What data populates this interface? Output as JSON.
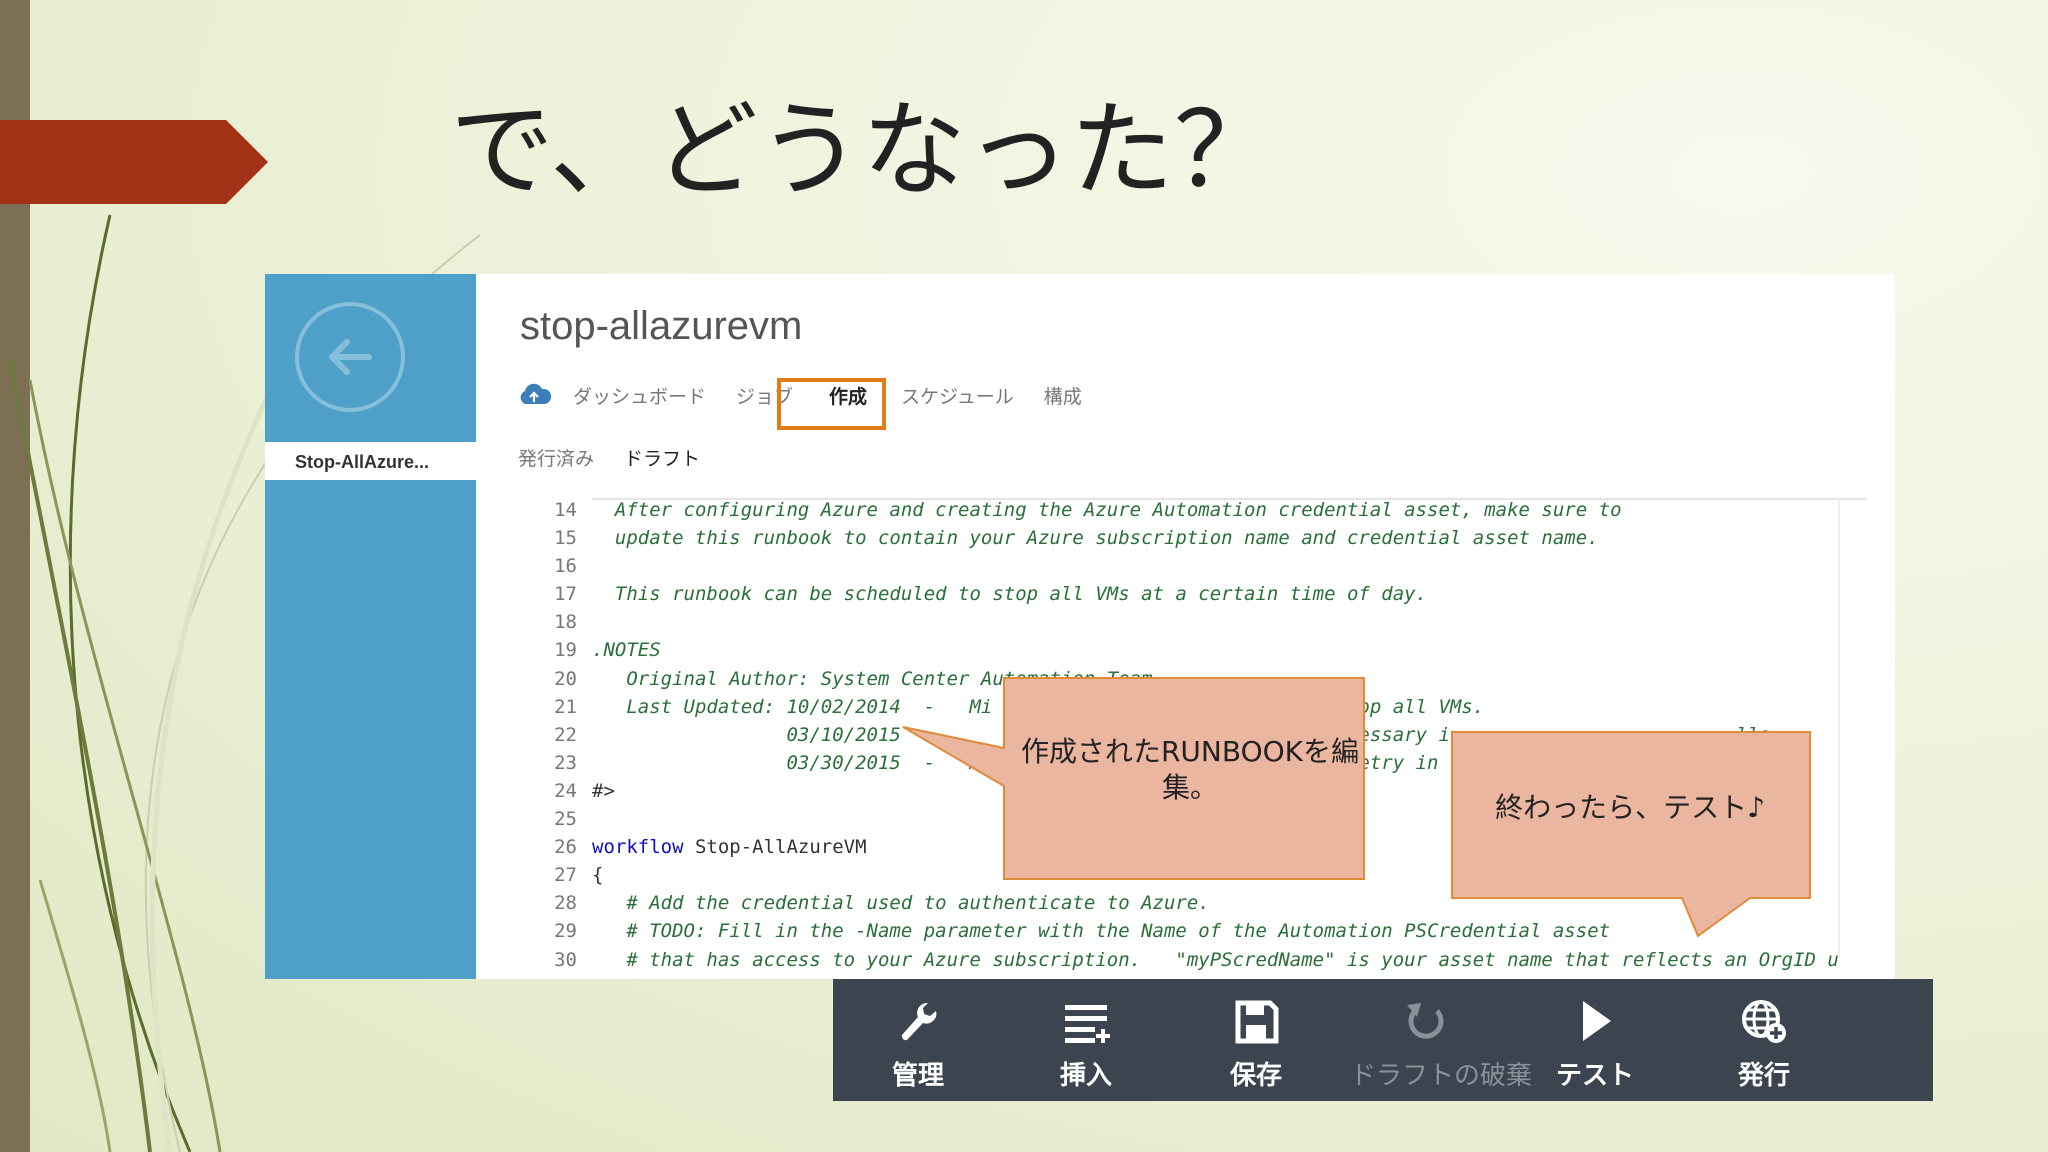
{
  "slide": {
    "title": "で、どうなった？"
  },
  "runbook": {
    "sidebar_item": "Stop-AllAzure...",
    "title": "stop-allazurevm",
    "tabs": [
      "ダッシュボード",
      "ジョブ",
      "作成",
      "スケジュール",
      "構成"
    ],
    "active_tab": "作成",
    "subtabs": [
      "発行済み",
      "ドラフト"
    ],
    "active_subtab": "ドラフト",
    "code_lines": [
      {
        "n": "14",
        "text": "  After configuring Azure and creating the Azure Automation credential asset, make sure to"
      },
      {
        "n": "15",
        "text": "  update this runbook to contain your Azure subscription name and credential asset name."
      },
      {
        "n": "16",
        "text": ""
      },
      {
        "n": "17",
        "text": "  This runbook can be scheduled to stop all VMs at a certain time of day."
      },
      {
        "n": "18",
        "text": ""
      },
      {
        "n": "19",
        "text": ".NOTES"
      },
      {
        "n": "20",
        "text": "   Original Author: System Center Automation Team"
      },
      {
        "n": "21",
        "text": "   Last Updated: 10/02/2014  -   Mi                               top all VMs."
      },
      {
        "n": "22",
        "text": "                 03/10/2015                                        essary i                         lle"
      },
      {
        "n": "23",
        "text": "                 03/30/2015  -   Mo                                etry in"
      },
      {
        "n": "24",
        "text": "#>"
      },
      {
        "n": "25",
        "text": ""
      },
      {
        "n": "26",
        "kw": "workflow",
        "text": " Stop-AllAzureVM"
      },
      {
        "n": "27",
        "text": "{"
      },
      {
        "n": "28",
        "text": "   # Add the credential used to authenticate to Azure."
      },
      {
        "n": "29",
        "text": "   # TODO: Fill in the -Name parameter with the Name of the Automation PSCredential asset"
      },
      {
        "n": "30",
        "text": "   # that has access to your Azure subscription.   \"myPScredName\" is your asset name that reflects an OrgID u"
      }
    ]
  },
  "callouts": {
    "edit": "作成されたRUNBOOKを編集。",
    "test": "終わったら、テスト♪"
  },
  "toolbar": {
    "buttons": [
      {
        "label": "管理",
        "icon": "wrench-icon",
        "enabled": true
      },
      {
        "label": "挿入",
        "icon": "insert-lines-icon",
        "enabled": true
      },
      {
        "label": "保存",
        "icon": "save-icon",
        "enabled": true
      },
      {
        "label": "ドラフトの破棄",
        "icon": "undo-icon",
        "enabled": false
      },
      {
        "label": "テスト",
        "icon": "play-icon",
        "enabled": true
      },
      {
        "label": "発行",
        "icon": "globe-publish-icon",
        "enabled": true
      }
    ]
  },
  "colors": {
    "sidebar": "#4ea0c8",
    "tab_highlight": "#e07b18",
    "callout_fill": "#ebb6a0",
    "callout_border": "#e08a3a",
    "toolbar": "#3c4450",
    "title_arrow": "#a33116"
  }
}
